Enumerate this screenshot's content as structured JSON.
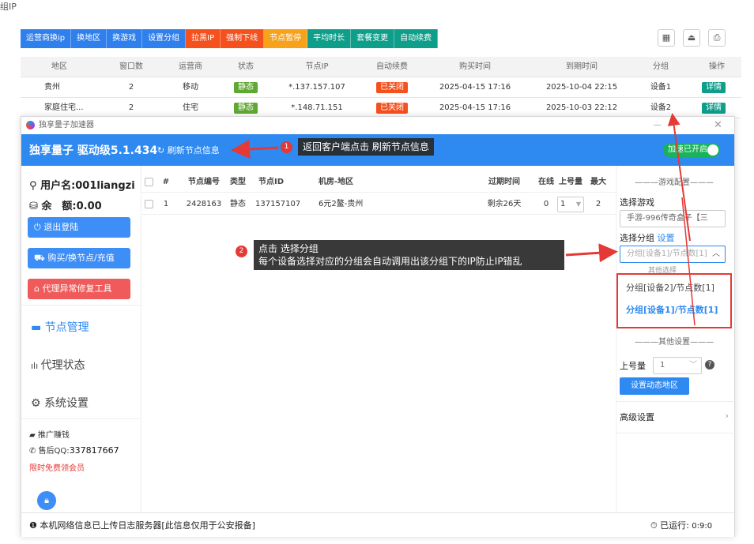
{
  "page_title": "组IP",
  "toolbar": {
    "buttons": [
      {
        "label": "运营商换ip",
        "color": "#2f80ed"
      },
      {
        "label": "换地区",
        "color": "#2f80ed"
      },
      {
        "label": "换游戏",
        "color": "#2f80ed"
      },
      {
        "label": "设置分组",
        "color": "#2f80ed"
      },
      {
        "label": "拉黑IP",
        "color": "#f4511e"
      },
      {
        "label": "强制下线",
        "color": "#f4511e"
      },
      {
        "label": "节点暂停",
        "color": "#f7a21b"
      },
      {
        "label": "平均时长",
        "color": "#0e9e8a"
      },
      {
        "label": "套餐变更",
        "color": "#0e9e8a"
      },
      {
        "label": "自动续费",
        "color": "#0e9e8a"
      }
    ],
    "right_icons": [
      "grid-icon",
      "export-icon",
      "print-icon"
    ]
  },
  "table": {
    "headers": [
      "地区",
      "窗口数",
      "运营商",
      "状态",
      "节点IP",
      "自动续费",
      "购买时间",
      "到期时间",
      "分组",
      "操作"
    ],
    "rows": [
      {
        "region": "贵州",
        "windows": "2",
        "carrier": "移动",
        "status": "静态",
        "ip": "*.137.157.107",
        "renew": "已关闭",
        "buy": "2025-04-15 17:16",
        "expire": "2025-10-04 22:15",
        "group": "设备1",
        "action": "详情"
      },
      {
        "region": "家庭住宅...",
        "windows": "2",
        "carrier": "住宅",
        "status": "静态",
        "ip": "*.148.71.151",
        "renew": "已关闭",
        "buy": "2025-04-15 17:16",
        "expire": "2025-10-03 22:12",
        "group": "设备2",
        "action": "详情"
      }
    ]
  },
  "app": {
    "window_title": "独享量子加速器",
    "brand": "独享量子 驱动级5.1.434",
    "refresh_label": "刷新节点信息",
    "accel_toggle": "加速已开启",
    "user": {
      "username": "用户名:001liangzi",
      "balance": "余　额:0.00"
    },
    "side_buttons": [
      "退出登陆",
      "购买/换节点/充值",
      "代理异常修复工具"
    ],
    "nav": [
      "节点管理",
      "代理状态",
      "系统设置"
    ],
    "promo": "推广赚钱",
    "support_label": "售后QQ:",
    "support_qq": "337817667",
    "vip": "限时免费领会员",
    "node_table": {
      "headers": [
        "#",
        "节点编号",
        "类型",
        "节点ID",
        "机房-地区",
        "过期时间",
        "在线",
        "上号量",
        "最大"
      ],
      "rows": [
        {
          "idx": "1",
          "code": "2428163",
          "type": "静态",
          "id": "137157107",
          "room": "6元2鳌-贵州",
          "expire": "剩余26天",
          "online": "0",
          "count": "1",
          "max": "2"
        }
      ]
    },
    "right_panel": {
      "game_section": "游戏配置",
      "select_game_label": "选择游戏",
      "select_game_value": "手游-996传奇盒子【三",
      "select_group_label": "选择分组",
      "select_group_link": "设置",
      "select_group_value": "分组[设备1]/节点数[1]",
      "dropdown_peek": "其他选择",
      "options": [
        "分组[设备2]/节点数[1]",
        "分组[设备1]/节点数[1]"
      ],
      "other_section": "其他设置",
      "login_count_label": "上号量",
      "login_count_value": "1",
      "dyn_region_btn": "设置动态地区",
      "advanced": "高级设置"
    },
    "footer": {
      "notice": "本机网络信息已上传日志服务器[此信息仅用于公安报备]",
      "runtime_label": "已运行:",
      "runtime_value": "0:9:0"
    }
  },
  "annotations": [
    {
      "num": "1",
      "text": "返回客户端点击 刷新节点信息"
    },
    {
      "num": "2",
      "line1": "点击 选择分组",
      "line2": "每个设备选择对应的分组会自动调用出该分组下的IP防止IP错乱"
    }
  ]
}
